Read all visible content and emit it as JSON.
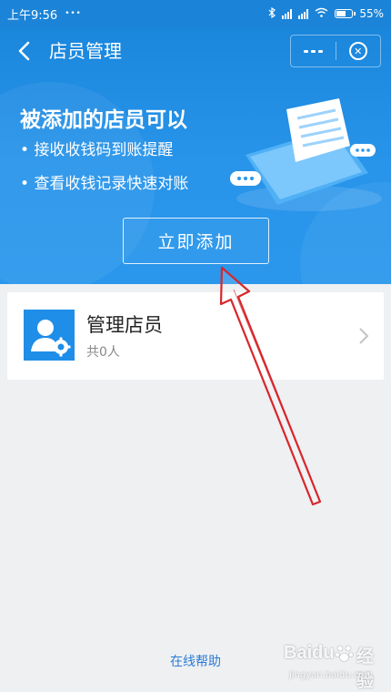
{
  "status_bar": {
    "time": "上午9:56",
    "dots": "• • •",
    "battery": "55%"
  },
  "header": {
    "title": "店员管理"
  },
  "promo": {
    "heading": "被添加的店员可以",
    "bullets": [
      "接收收钱码到账提醒",
      "查看收钱记录快速对账"
    ],
    "cta_label": "立即添加"
  },
  "staff_card": {
    "title": "管理店员",
    "count_text": "共0人"
  },
  "footer": {
    "help_label": "在线帮助"
  },
  "watermark": {
    "brand": "Baidu",
    "sub": "经验",
    "url": "jingyan.baidu.com"
  },
  "colors": {
    "primary": "#2894ea",
    "header": "#1b84d8",
    "link": "#2b7bd6",
    "annotation_arrow": "#d8262b"
  }
}
